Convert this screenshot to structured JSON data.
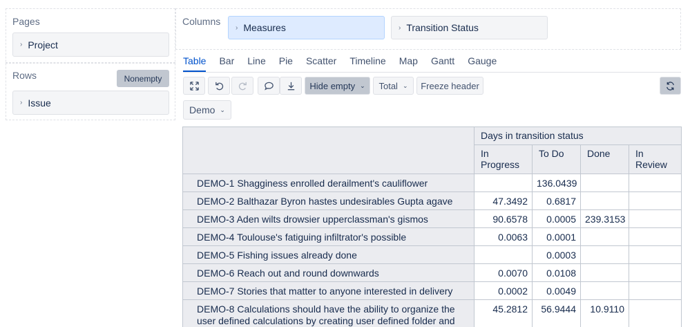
{
  "pages": {
    "label": "Pages",
    "items": [
      {
        "label": "Project"
      }
    ]
  },
  "rows": {
    "label": "Rows",
    "nonempty_label": "Nonempty",
    "items": [
      {
        "label": "Issue"
      }
    ]
  },
  "columns": {
    "label": "Columns",
    "items": [
      {
        "label": "Measures"
      },
      {
        "label": "Transition Status"
      }
    ]
  },
  "tabs": [
    "Table",
    "Bar",
    "Line",
    "Pie",
    "Scatter",
    "Timeline",
    "Map",
    "Gantt",
    "Gauge"
  ],
  "toolbar": {
    "hide_empty": "Hide empty",
    "total": "Total",
    "freeze_header": "Freeze header"
  },
  "filter": {
    "label": "Demo"
  },
  "table": {
    "measure_header": "Days in transition status",
    "columns": [
      {
        "line1": "In",
        "line2": "Progress"
      },
      {
        "line1": "To Do",
        "line2": ""
      },
      {
        "line1": "Done",
        "line2": ""
      },
      {
        "line1": "In",
        "line2": "Review"
      }
    ],
    "rows": [
      {
        "label": "DEMO-1 Shagginess enrolled derailment's cauliflower",
        "values": [
          "",
          "136.0439",
          "",
          ""
        ]
      },
      {
        "label": "DEMO-2 Balthazar Byron hastes undesirables Gupta agave",
        "values": [
          "47.3492",
          "0.6817",
          "",
          ""
        ]
      },
      {
        "label": "DEMO-3 Aden wilts drowsier upperclassman's gismos",
        "values": [
          "90.6578",
          "0.0005",
          "239.3153",
          ""
        ]
      },
      {
        "label": "DEMO-4 Toulouse's fatiguing infiltrator's possible",
        "values": [
          "0.0063",
          "0.0001",
          "",
          ""
        ]
      },
      {
        "label": "DEMO-5 Fishing issues already done",
        "values": [
          "",
          "0.0003",
          "",
          ""
        ]
      },
      {
        "label": "DEMO-6 Reach out and round downwards",
        "values": [
          "0.0070",
          "0.0108",
          "",
          ""
        ]
      },
      {
        "label": "DEMO-7 Stories that matter to anyone interested in delivery",
        "values": [
          "0.0002",
          "0.0049",
          "",
          ""
        ]
      },
      {
        "label": "DEMO-8 Calculations should have the ability to organize the user defined calculations by creating user defined folder and",
        "values": [
          "45.2812",
          "56.9444",
          "10.9110",
          ""
        ]
      }
    ]
  }
}
